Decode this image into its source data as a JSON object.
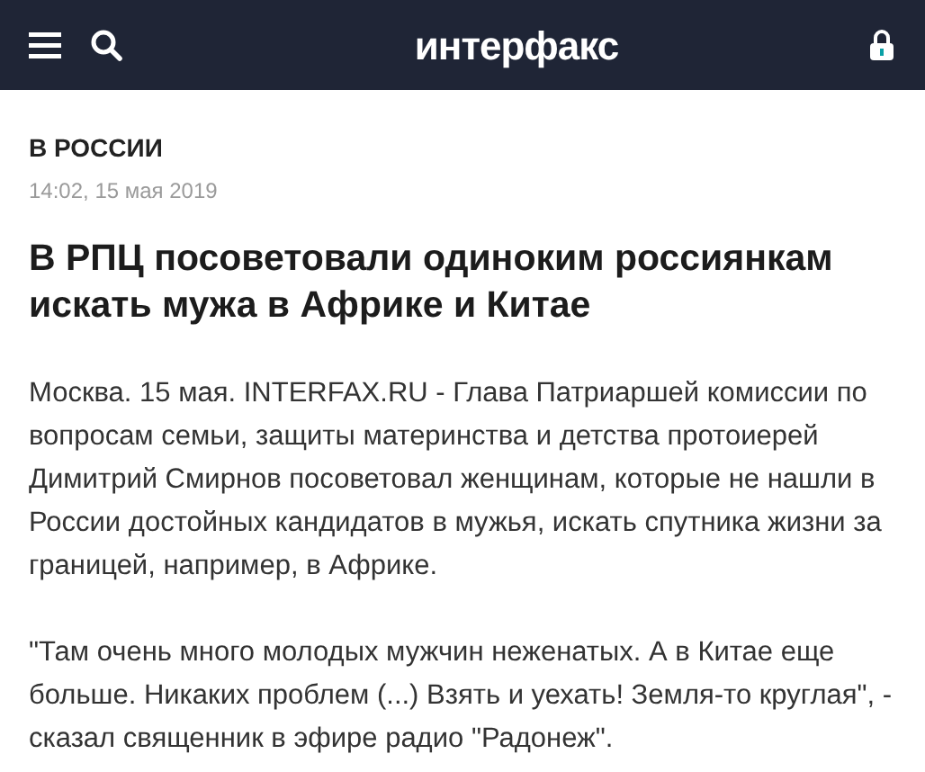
{
  "header": {
    "logo": "интерфакс"
  },
  "article": {
    "section": "В РОССИИ",
    "date": "14:02, 15 мая 2019",
    "title": "В РПЦ посоветовали одиноким россиянкам искать мужа в Африке и Китае",
    "paragraphs": [
      "Москва. 15 мая. INTERFAX.RU - Глава Патриаршей комиссии по вопросам семьи, защиты материнства и детства протоиерей Димитрий Смирнов посоветовал женщинам, которые не нашли в России достойных кандидатов в мужья, искать спутника жизни за границей, например, в Африке.",
      "\"Там очень много молодых мужчин неженатых. А в Китае еще больше. Никаких проблем (...) Взять и уехать! Земля-то круглая\", - сказал священник в эфире радио \"Радонеж\"."
    ]
  }
}
